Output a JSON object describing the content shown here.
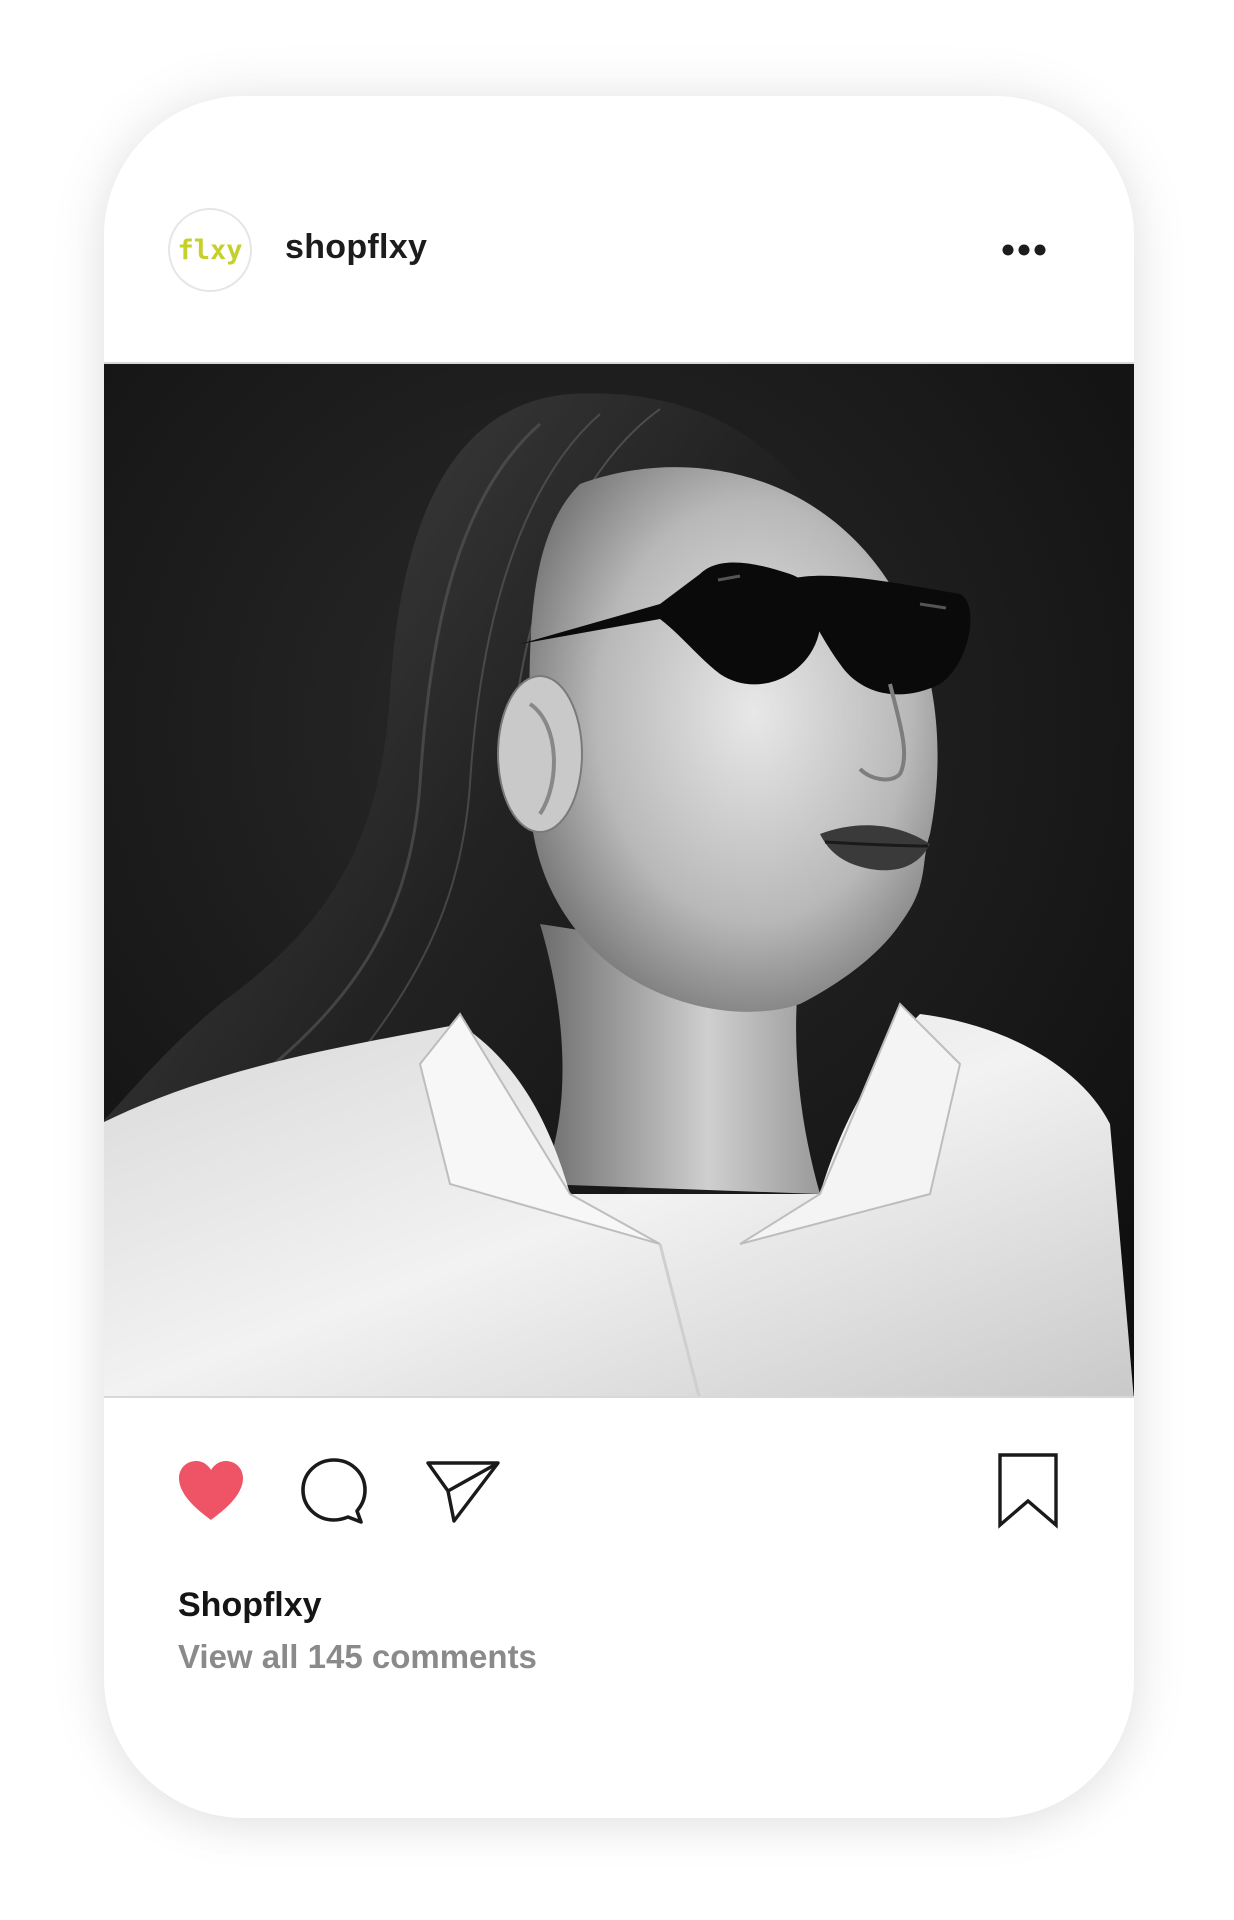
{
  "post": {
    "avatar_text": "flxy",
    "username": "shopflxy",
    "caption_name": "Shopflxy",
    "comments_link": "View all 145 comments"
  },
  "colors": {
    "like": "#ef5466",
    "avatar_brand": "#c6d02a",
    "muted_text": "#8a8a8a"
  },
  "icons": {
    "more": "more-dots-icon",
    "like": "heart-filled-icon",
    "comment": "comment-bubble-icon",
    "share": "paper-plane-icon",
    "save": "bookmark-icon"
  }
}
